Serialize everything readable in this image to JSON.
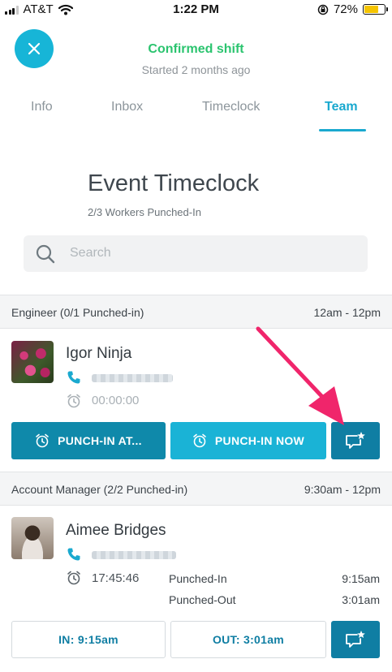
{
  "status_bar": {
    "carrier": "AT&T",
    "time": "1:22 PM",
    "battery": "72%",
    "battery_level": 0.72
  },
  "header": {
    "title": "Confirmed shift",
    "subtitle": "Started 2 months ago"
  },
  "tabs": [
    {
      "label": "Info"
    },
    {
      "label": "Inbox"
    },
    {
      "label": "Timeclock"
    },
    {
      "label": "Team"
    }
  ],
  "page": {
    "title": "Event Timeclock",
    "subtitle": "2/3 Workers Punched-In"
  },
  "search": {
    "placeholder": "Search"
  },
  "groups": [
    {
      "name": "Engineer (0/1 Punched-in)",
      "time": "12am - 12pm",
      "worker": {
        "name": "Igor Ninja",
        "elapsed": "00:00:00",
        "buttons": {
          "punch_in_at": "PUNCH-IN AT...",
          "punch_in_now": "PUNCH-IN NOW"
        }
      }
    },
    {
      "name": "Account Manager (2/2 Punched-in)",
      "time": "9:30am - 12pm",
      "worker": {
        "name": "Aimee Bridges",
        "elapsed": "17:45:46",
        "punched_in_label": "Punched-In",
        "punched_in_time": "9:15am",
        "punched_out_label": "Punched-Out",
        "punched_out_time": "3:01am",
        "buttons": {
          "in": "IN: 9:15am",
          "out": "OUT: 3:01am"
        }
      }
    }
  ],
  "colors": {
    "accent": "#1aa9cf",
    "confirmed": "#2bc46f",
    "button_dark": "#0f89aa",
    "arrow": "#f0256b"
  }
}
